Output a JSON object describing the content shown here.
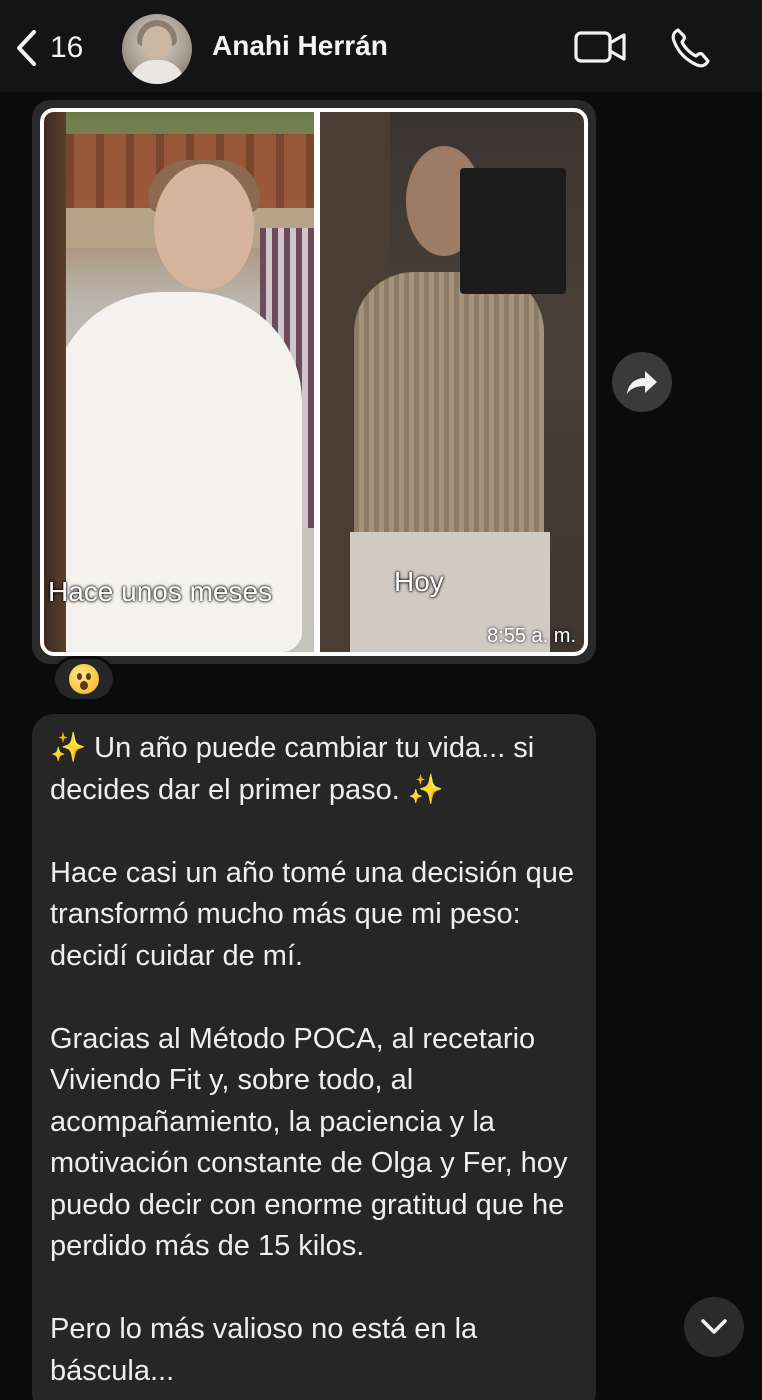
{
  "header": {
    "back_count": "16",
    "contact_name": "Anahi Herrán",
    "icons": [
      "chevron-left-icon",
      "video-camera-icon",
      "phone-icon"
    ]
  },
  "photo_message": {
    "label_left": "Hace unos meses",
    "label_right": "Hoy",
    "time": "8:55 a. m.",
    "reaction": "😮"
  },
  "text_message": {
    "paragraphs": [
      {
        "lead_sparkle": "✨",
        "text": " Un año puede cambiar tu vida... si decides dar el primer paso. ",
        "trail_sparkle": "✨"
      },
      {
        "text": "Hace casi un año tomé una decisión que transformó mucho más que mi peso: decidí cuidar de mí."
      },
      {
        "text": "Gracias al Método POCA, al recetario Viviendo Fit y, sobre todo, al acompañamiento, la paciencia y la motivación constante de Olga y Fer, hoy puedo decir con enorme gratitud que he perdido más de 15 kilos."
      },
      {
        "text": "Pero lo más valioso no está en la báscula..."
      }
    ]
  },
  "colors": {
    "background": "#0b0b0b",
    "header": "#141414",
    "bubble": "#262626",
    "text": "#eeeeee"
  }
}
